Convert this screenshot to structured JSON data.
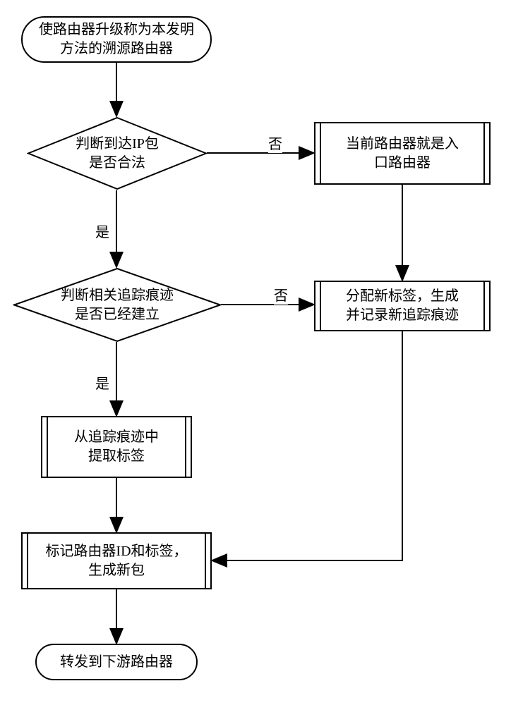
{
  "chart_data": {
    "type": "flowchart",
    "nodes": [
      {
        "id": "start",
        "kind": "terminator",
        "text_lines": [
          "使路由器升级称为本发明",
          "方法的溯源路由器"
        ]
      },
      {
        "id": "d1",
        "kind": "decision",
        "text_lines": [
          "判断到达IP包",
          "是否合法"
        ]
      },
      {
        "id": "p_entry",
        "kind": "process",
        "text_lines": [
          "当前路由器就是入",
          "口路由器"
        ]
      },
      {
        "id": "d2",
        "kind": "decision",
        "text_lines": [
          "判断相关追踪痕迹",
          "是否已经建立"
        ]
      },
      {
        "id": "p_newlabel",
        "kind": "process",
        "text_lines": [
          "分配新标签，生成",
          "并记录新追踪痕迹"
        ]
      },
      {
        "id": "p_extract",
        "kind": "process",
        "text_lines": [
          "从追踪痕迹中",
          "提取标签"
        ]
      },
      {
        "id": "p_mark",
        "kind": "process",
        "text_lines": [
          "标记路由器ID和标签，",
          "生成新包"
        ]
      },
      {
        "id": "end",
        "kind": "terminator",
        "text_lines": [
          "转发到下游路由器"
        ]
      }
    ],
    "edges": [
      {
        "from": "start",
        "to": "d1",
        "label": ""
      },
      {
        "from": "d1",
        "to": "p_entry",
        "label": "否"
      },
      {
        "from": "d1",
        "to": "d2",
        "label": "是"
      },
      {
        "from": "p_entry",
        "to": "p_newlabel",
        "label": ""
      },
      {
        "from": "d2",
        "to": "p_newlabel",
        "label": "否"
      },
      {
        "from": "d2",
        "to": "p_extract",
        "label": "是"
      },
      {
        "from": "p_extract",
        "to": "p_mark",
        "label": ""
      },
      {
        "from": "p_newlabel",
        "to": "p_mark",
        "label": ""
      },
      {
        "from": "p_mark",
        "to": "end",
        "label": ""
      }
    ],
    "edge_labels": {
      "yes": "是",
      "no": "否"
    }
  }
}
